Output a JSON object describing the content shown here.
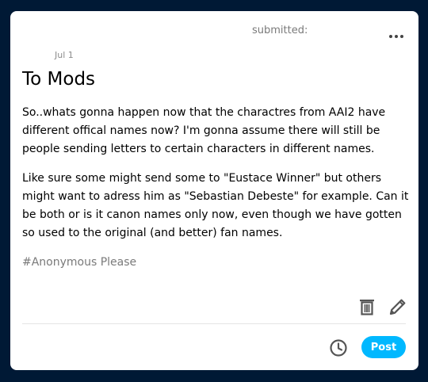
{
  "post": {
    "date": "Jul 1",
    "submitted_label": "submitted:",
    "title": "To Mods",
    "paragraphs": [
      "So..whats gonna happen now that the charactres from AAI2 have different offical names now? I'm gonna assume there will still be people sending letters to certain characters in different names.",
      "Like sure some might send some to \"Eustace Winner\" but others might want to adress him as \"Sebastian Debeste\" for example. Can it be both or is it canon names only now, even though we have gotten so used to the original (and better) fan names."
    ],
    "tag": "#Anonymous Please"
  },
  "actions": {
    "post_label": "Post"
  },
  "icons": {
    "more": "more-options-icon",
    "delete": "trash-icon",
    "edit": "pencil-icon",
    "schedule": "clock-icon"
  },
  "colors": {
    "background": "#001935",
    "card": "#ffffff",
    "accent": "#00b8ff",
    "muted_text": "#7a7a7a"
  }
}
